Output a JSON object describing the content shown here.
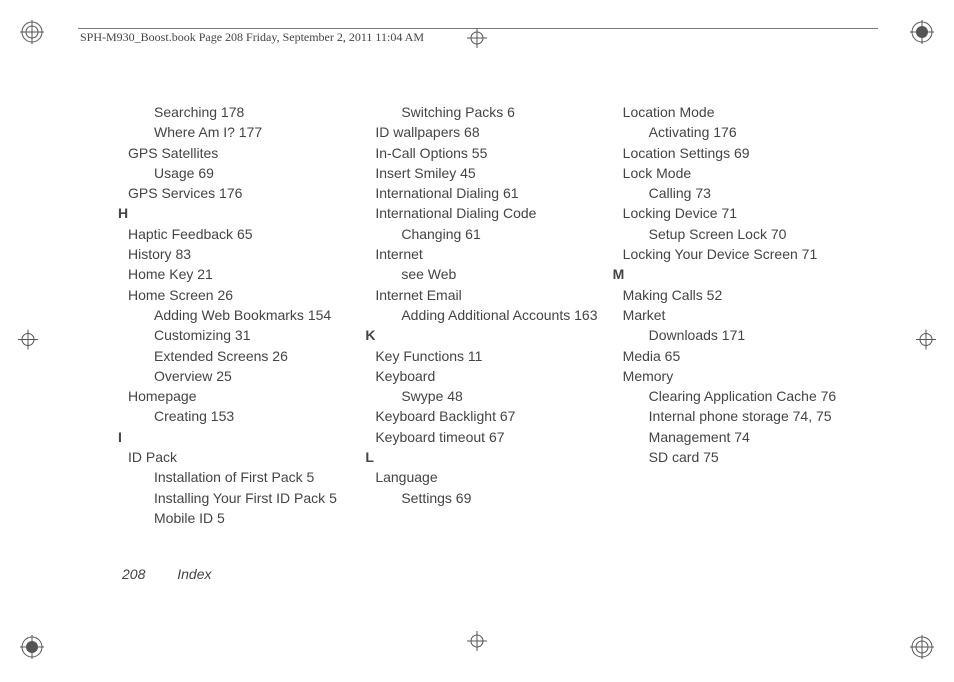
{
  "header": "SPH-M930_Boost.book  Page 208  Friday, September 2, 2011  11:04 AM",
  "footer": {
    "page": "208",
    "section": "Index"
  },
  "cols": [
    [
      {
        "cls": "lvl1",
        "t": "Searching 178"
      },
      {
        "cls": "lvl1",
        "t": "Where Am I? 177"
      },
      {
        "cls": "lvl0",
        "t": "GPS Satellites"
      },
      {
        "cls": "lvl1",
        "t": "Usage 69"
      },
      {
        "cls": "lvl0",
        "t": "GPS Services 176"
      },
      {
        "cls": "letter-head",
        "t": "H"
      },
      {
        "cls": "lvl0",
        "t": "Haptic Feedback 65"
      },
      {
        "cls": "lvl0",
        "t": "History 83"
      },
      {
        "cls": "lvl0",
        "t": "Home Key 21"
      },
      {
        "cls": "lvl0",
        "t": "Home Screen 26"
      },
      {
        "cls": "hang1",
        "t": "Adding Web Bookmarks 154"
      },
      {
        "cls": "lvl1",
        "t": "Customizing 31"
      },
      {
        "cls": "lvl1",
        "t": "Extended Screens 26"
      },
      {
        "cls": "lvl1",
        "t": "Overview 25"
      },
      {
        "cls": "lvl0",
        "t": "Homepage"
      },
      {
        "cls": "lvl1",
        "t": "Creating 153"
      },
      {
        "cls": "letter-head",
        "t": "I"
      },
      {
        "cls": "lvl0",
        "t": "ID Pack"
      },
      {
        "cls": "lvl1",
        "t": "Installation of First Pack 5"
      },
      {
        "cls": "lvl1",
        "t": "Installing Your First ID Pack 5"
      },
      {
        "cls": "lvl1",
        "t": "Mobile ID 5"
      }
    ],
    [
      {
        "cls": "lvl1",
        "t": "Switching Packs 6"
      },
      {
        "cls": "lvl0",
        "t": "ID wallpapers 68"
      },
      {
        "cls": "lvl0",
        "t": "In-Call Options 55"
      },
      {
        "cls": "lvl0",
        "t": "Insert Smiley 45"
      },
      {
        "cls": "lvl0",
        "t": "International Dialing 61"
      },
      {
        "cls": "lvl0",
        "t": "International Dialing Code"
      },
      {
        "cls": "lvl1",
        "t": "Changing 61"
      },
      {
        "cls": "lvl0",
        "t": "Internet"
      },
      {
        "cls": "lvl1",
        "t": "see Web"
      },
      {
        "cls": "lvl0",
        "t": "Internet Email"
      },
      {
        "cls": "hang1",
        "t": "Adding Additional Accounts 163"
      },
      {
        "cls": "letter-head",
        "t": "K"
      },
      {
        "cls": "lvl0",
        "t": "Key Functions 11"
      },
      {
        "cls": "lvl0",
        "t": "Keyboard"
      },
      {
        "cls": "lvl1",
        "t": "Swype 48"
      },
      {
        "cls": "lvl0",
        "t": "Keyboard Backlight 67"
      },
      {
        "cls": "lvl0",
        "t": "Keyboard timeout 67"
      },
      {
        "cls": "letter-head",
        "t": "L"
      },
      {
        "cls": "lvl0",
        "t": "Language"
      },
      {
        "cls": "lvl1",
        "t": "Settings 69"
      }
    ],
    [
      {
        "cls": "lvl0",
        "t": "Location Mode"
      },
      {
        "cls": "lvl1",
        "t": "Activating 176"
      },
      {
        "cls": "lvl0",
        "t": "Location Settings 69"
      },
      {
        "cls": "lvl0",
        "t": "Lock Mode"
      },
      {
        "cls": "lvl1",
        "t": "Calling 73"
      },
      {
        "cls": "lvl0",
        "t": "Locking Device 71"
      },
      {
        "cls": "lvl1",
        "t": "Setup Screen Lock 70"
      },
      {
        "cls": "hang1",
        "t": "Locking Your Device Screen 71",
        "sp": true
      },
      {
        "cls": "letter-head",
        "t": "M"
      },
      {
        "cls": "lvl0",
        "t": "Making Calls 52"
      },
      {
        "cls": "lvl0",
        "t": "Market"
      },
      {
        "cls": "lvl1",
        "t": "Downloads 171"
      },
      {
        "cls": "lvl0",
        "t": "Media 65"
      },
      {
        "cls": "lvl0",
        "t": "Memory"
      },
      {
        "cls": "hang1",
        "t": "Clearing Application Cache 76"
      },
      {
        "cls": "hang1",
        "t": "Internal phone storage 74, 75"
      },
      {
        "cls": "lvl1",
        "t": "Management 74"
      },
      {
        "cls": "lvl1",
        "t": "SD card 75"
      }
    ]
  ]
}
